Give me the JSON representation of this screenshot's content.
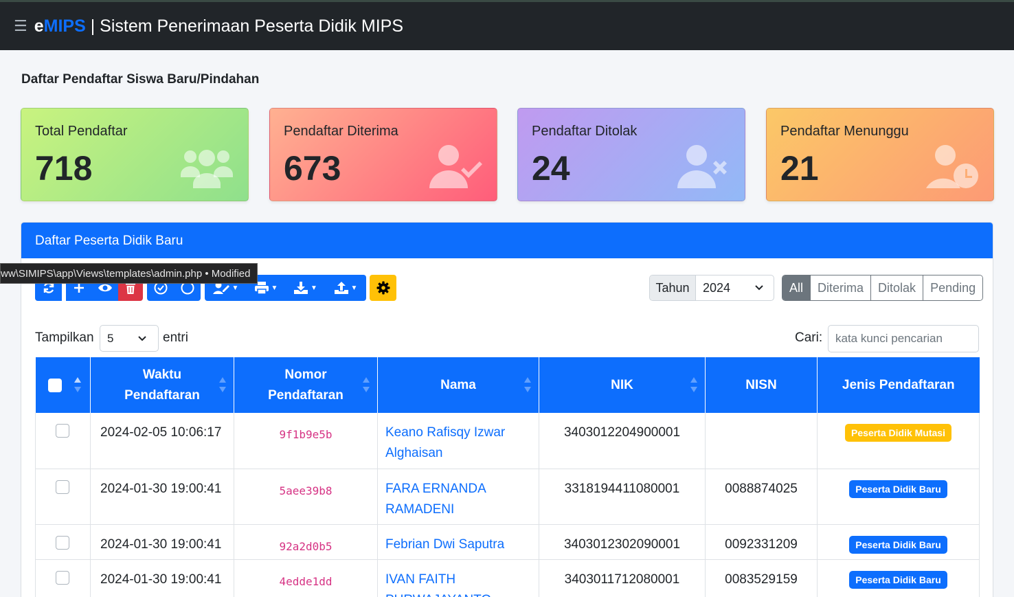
{
  "app": {
    "brand_e": "e",
    "brand_mips": "MIPS",
    "brand_separator": " | ",
    "title": "Sistem Penerimaan Peserta Didik MIPS"
  },
  "page": {
    "title": "Daftar Pendaftar Siswa Baru/Pindahan"
  },
  "stats": [
    {
      "label": "Total Pendaftar",
      "value": "718",
      "icon": "users-icon"
    },
    {
      "label": "Pendaftar Diterima",
      "value": "673",
      "icon": "user-check-icon"
    },
    {
      "label": "Pendaftar Ditolak",
      "value": "24",
      "icon": "user-times-icon"
    },
    {
      "label": "Pendaftar Menunggu",
      "value": "21",
      "icon": "user-clock-icon"
    }
  ],
  "card": {
    "title": "Daftar Peserta Didik Baru"
  },
  "tooltip": {
    "text": "ww\\SIMIPS\\app\\Views\\templates\\admin.php • Modified"
  },
  "toolbar": {
    "buttons": [
      "refresh-icon",
      "plus-icon",
      "eye-icon",
      "trash-icon",
      "check-circle-icon",
      "circle-icon",
      "user-edit-icon",
      "print-icon",
      "download-icon",
      "upload-icon",
      "gear-icon"
    ]
  },
  "year": {
    "label": "Tahun",
    "value": "2024"
  },
  "filters": [
    {
      "label": "All",
      "active": true
    },
    {
      "label": "Diterima",
      "active": false
    },
    {
      "label": "Ditolak",
      "active": false
    },
    {
      "label": "Pending",
      "active": false
    }
  ],
  "datatable": {
    "show_label": "Tampilkan",
    "page_size": "5",
    "entries_label": "entri",
    "search_label": "Cari:",
    "search_placeholder": "kata kunci pencarian"
  },
  "table": {
    "columns": [
      "Waktu Pendaftaran",
      "Nomor Pendaftaran",
      "Nama",
      "NIK",
      "NISN",
      "Jenis Pendaftaran"
    ],
    "rows": [
      {
        "time": "2024-02-05 10:06:17",
        "code": "9f1b9e5b",
        "name": "Keano Rafisqy Izwar Alghaisan",
        "nik": "3403012204900001",
        "nisn": "",
        "type": "Peserta Didik Mutasi",
        "type_color": "#ffc107"
      },
      {
        "time": "2024-01-30 19:00:41",
        "code": "5aee39b8",
        "name": "FARA ERNANDA RAMADENI",
        "nik": "3318194411080001",
        "nisn": "0088874025",
        "type": "Peserta Didik Baru",
        "type_color": "#0d6efd"
      },
      {
        "time": "2024-01-30 19:00:41",
        "code": "92a2d0b5",
        "name": "Febrian Dwi Saputra",
        "nik": "3403012302090001",
        "nisn": "0092331209",
        "type": "Peserta Didik Baru",
        "type_color": "#0d6efd"
      },
      {
        "time": "2024-01-30 19:00:41",
        "code": "4edde1dd",
        "name": "IVAN FAITH PURWAJAYANTO",
        "nik": "3403011712080001",
        "nisn": "0083529159",
        "type": "Peserta Didik Baru",
        "type_color": "#0d6efd"
      }
    ]
  },
  "colors": {
    "primary": "#0d6efd",
    "danger": "#dc3545",
    "warning": "#ffc107",
    "secondary": "#6c757d",
    "navbar": "#212529"
  }
}
